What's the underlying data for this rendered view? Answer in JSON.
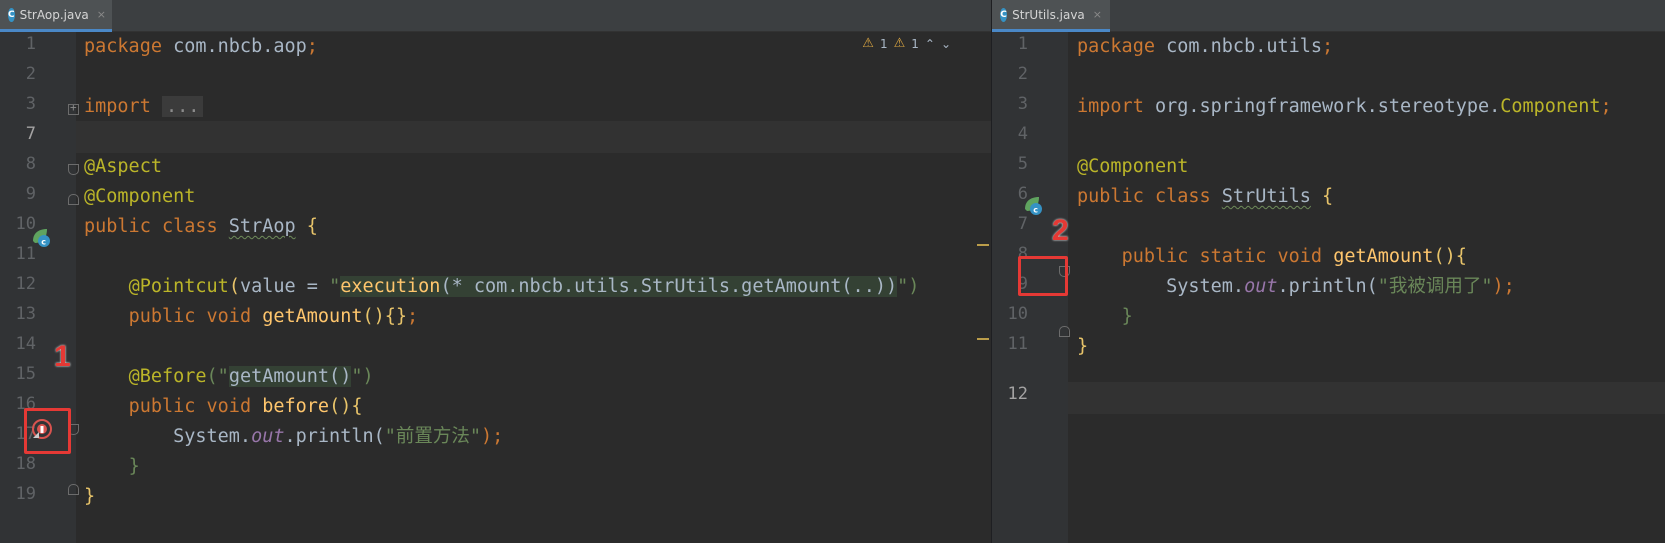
{
  "left": {
    "tab": {
      "title": "StrAop.java",
      "icon": "C",
      "close": "×"
    },
    "warnings": {
      "count_a": "1",
      "count_b": "1",
      "up": "⌃",
      "down": "⌄"
    },
    "line_numbers": [
      "1",
      "2",
      "3",
      "7",
      "8",
      "9",
      "10",
      "11",
      "12",
      "13",
      "14",
      "15",
      "16",
      "17",
      "18",
      "19"
    ],
    "code": {
      "l1_kw": "package",
      "l1_rest": " com.nbcb.aop",
      "l1_semi": ";",
      "l3_kw": "import",
      "l3_fold": "...",
      "l8": "@Aspect",
      "l9": "@Component",
      "l10_kw": "public class",
      "l10_cls": "StrAop",
      "l10_brace": "{",
      "l12_ann": "@Pointcut",
      "l12_p1": "(",
      "l12_attr": "value = ",
      "l12_q1": "\"",
      "l12_str": "execution",
      "l12_str2": "(* com.nbcb.utils.StrUtils.getAmount(..))",
      "l12_q2": "\")",
      "l13_kw": "public void",
      "l13_fn": "getAmount",
      "l13_rest": "(){}",
      "l13_semi": ";",
      "l15_ann": "@Before",
      "l15_p1": "(\"",
      "l15_str": "getAmount()",
      "l15_p2": "\")",
      "l16_kw": "public void",
      "l16_fn": "before",
      "l16_rest": "(){",
      "l17_cls": "System.",
      "l17_fld": "out",
      "l17_m": ".println(",
      "l17_str": "\"前置方法\"",
      "l17_end": ");",
      "l18": "}",
      "l19": "}"
    },
    "annotation_label": "1"
  },
  "right": {
    "tab": {
      "title": "StrUtils.java",
      "icon": "C",
      "close": "×"
    },
    "line_numbers": [
      "1",
      "2",
      "3",
      "4",
      "5",
      "6",
      "7",
      "8",
      "9",
      "10",
      "11",
      "12"
    ],
    "code": {
      "l1_kw": "package",
      "l1_rest": " com.nbcb.utils",
      "l1_semi": ";",
      "l3_kw": "import",
      "l3_rest": " org.springframework.stereotype.",
      "l3_cls": "Component",
      "l3_semi": ";",
      "l5": "@Component",
      "l6_kw": "public class",
      "l6_cls": "StrUtils",
      "l6_brace": "{",
      "l8_kw": "public static void",
      "l8_fn": "getAmount",
      "l8_rest": "(){",
      "l9_cls": "System.",
      "l9_fld": "out",
      "l9_m": ".println(",
      "l9_str": "\"我被调用了\"",
      "l9_end": ");",
      "l10": "}",
      "l11": "}"
    },
    "annotation_label": "2"
  },
  "colors": {
    "keyword": "#cc7832",
    "annotation": "#bbb529",
    "string": "#6a8759",
    "function": "#ffc66d",
    "field": "#9876aa",
    "background": "#2b2b2b",
    "highlight_box": "#e53935"
  }
}
